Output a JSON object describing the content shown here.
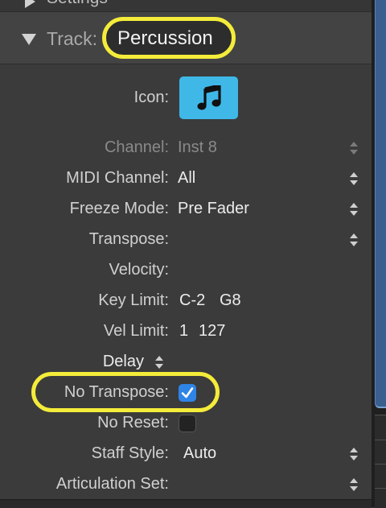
{
  "settings_section": {
    "label": "Settings"
  },
  "track_section": {
    "label": "Track:",
    "name": "Percussion"
  },
  "rows": {
    "icon": {
      "label": "Icon:",
      "icon_name": "music-note-icon"
    },
    "channel": {
      "label": "Channel:",
      "value": "Inst 8"
    },
    "midi_channel": {
      "label": "MIDI Channel:",
      "value": "All"
    },
    "freeze_mode": {
      "label": "Freeze Mode:",
      "value": "Pre Fader"
    },
    "transpose": {
      "label": "Transpose:",
      "value": ""
    },
    "velocity": {
      "label": "Velocity:",
      "value": ""
    },
    "key_limit": {
      "label": "Key Limit:",
      "low": "C-2",
      "high": "G8"
    },
    "vel_limit": {
      "label": "Vel Limit:",
      "low": "1",
      "high": "127"
    },
    "delay": {
      "label": "Delay"
    },
    "no_transpose": {
      "label": "No Transpose:",
      "checked": true
    },
    "no_reset": {
      "label": "No Reset:",
      "checked": false
    },
    "staff_style": {
      "label": "Staff Style:",
      "value": "Auto"
    },
    "articulation_set": {
      "label": "Articulation Set:",
      "value": ""
    }
  },
  "colors": {
    "highlight": "#f4ec3a",
    "icon_bg": "#3fb8e8",
    "checkbox_on": "#2f84e7",
    "panel_bg": "#3b3b3b"
  }
}
